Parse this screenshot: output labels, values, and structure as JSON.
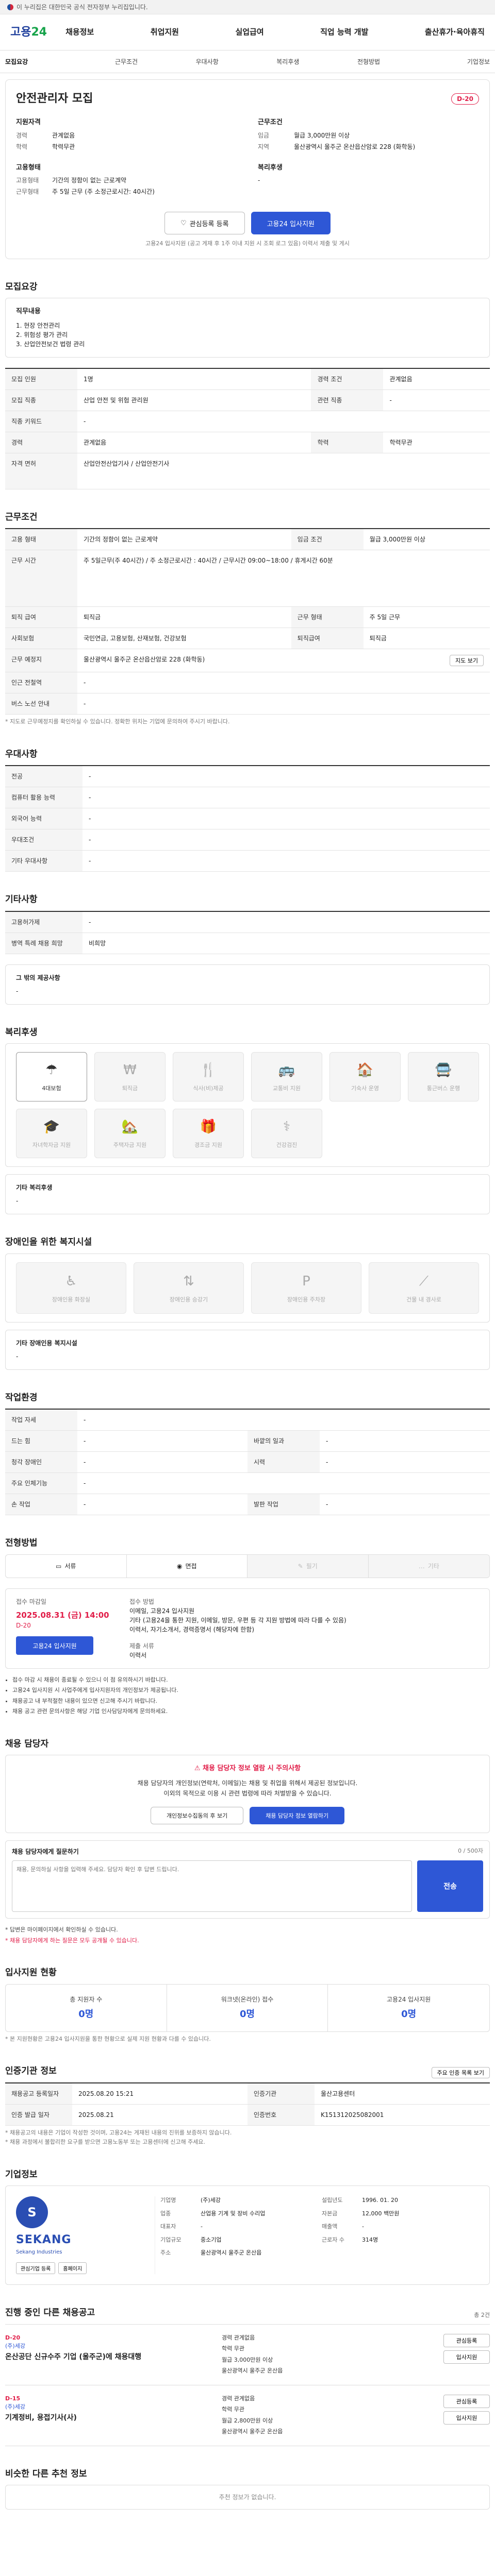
{
  "gov_banner": "이 누리집은 대한민국 공식 전자정부 누리집입니다.",
  "header": {
    "logo_main": "고용",
    "logo_accent": "24",
    "nav": [
      "채용정보",
      "취업지원",
      "실업급여",
      "직업 능력 개발",
      "출산휴가·육아휴직"
    ]
  },
  "tabs": [
    "모집요강",
    "근무조건",
    "우대사항",
    "복리후생",
    "전형방법",
    "기업정보"
  ],
  "job": {
    "title": "안전관리자 모집",
    "dday": "D-20",
    "apply_qualification": {
      "heading": "지원자격",
      "rows": [
        {
          "k": "경력",
          "v": "관계없음"
        },
        {
          "k": "학력",
          "v": "학력무관"
        }
      ]
    },
    "work_conditions": {
      "heading": "근무조건",
      "rows": [
        {
          "k": "임금",
          "v": "월급 3,000만원 이상"
        },
        {
          "k": "지역",
          "v": "울산광역시 울주군 온산읍산암로 228 (화학동)"
        }
      ]
    },
    "employment_type": {
      "heading": "고용형태",
      "rows": [
        {
          "k": "고용형태",
          "v": "기간의 정함이 없는 근로계약"
        },
        {
          "k": "근무형태",
          "v": "주 5일 근무 (주 소정근로시간: 40시간)"
        }
      ]
    },
    "welfare_brief": {
      "heading": "복리후생",
      "value": "-"
    },
    "btn_scrap": "관심등록 등록",
    "btn_apply": "고용24 입사지원",
    "apply_note": "고용24 입사지원 (공고 게재 후 1주 이내 지원 시 조회 로그 있음) 이력서 제출 및 게시"
  },
  "recruit": {
    "title": "모집요강",
    "desc_heading": "직무내용",
    "desc_lines": [
      "1. 현장 안전관리",
      "2. 위험성 평가 관리",
      "3. 산업안전보건 법령 관리"
    ],
    "rows": [
      {
        "k": "모집 인원",
        "v": "1명",
        "k2": "경력 조건",
        "v2": "관계없음"
      },
      {
        "k": "모집 직종",
        "v": "산업 안전 및 위험 관리원",
        "k2": "관련 직종",
        "v2": "-"
      },
      {
        "k": "직종 키워드",
        "v": "-",
        "k2": "",
        "v2": ""
      },
      {
        "k": "경력",
        "v": "관계없음",
        "k2": "학력",
        "v2": "학력무관"
      },
      {
        "k": "자격 면허",
        "v": "산업안전산업기사 / 산업안전기사",
        "k2": "",
        "v2": ""
      }
    ]
  },
  "conditions": {
    "title": "근무조건",
    "rows": [
      {
        "k": "고용 형태",
        "v": "기간의 정함이 없는 근로계약",
        "k2": "임금 조건",
        "v2": "월급 3,000만원 이상"
      },
      {
        "k": "근무 시간",
        "v": "주 5일근무(주 40시간) / 주 소정근로시간 : 40시간 / 근무시간 09:00~18:00 / 휴게시간 60분",
        "k2": "",
        "v2": ""
      },
      {
        "k": "퇴직 급여",
        "v": "퇴직금",
        "k2": "근무 형태",
        "v2": "주 5일 근무"
      },
      {
        "k": "사회보험",
        "v": "국민연금, 고용보험, 산재보험, 건강보험",
        "k2": "퇴직급여",
        "v2": "퇴직금"
      },
      {
        "k": "근무 예정지",
        "v": "울산광역시 울주군 온산읍산암로 228 (화학동)",
        "k2": "",
        "v2": ""
      },
      {
        "k": "인근 전철역",
        "v": "-",
        "k2": "",
        "v2": ""
      },
      {
        "k": "버스 노선 안내",
        "v": "-",
        "k2": "",
        "v2": ""
      }
    ],
    "map_button": "지도 보기",
    "note": "* 지도로 근무예정지를 확인하실 수 있습니다. 정확한 위치는 기업에 문의하여 주시기 바랍니다."
  },
  "preferences": {
    "title": "우대사항",
    "rows": [
      {
        "k": "전공",
        "v": "-"
      },
      {
        "k": "컴퓨터 활용 능력",
        "v": "-"
      },
      {
        "k": "외국어 능력",
        "v": "-"
      },
      {
        "k": "우대조건",
        "v": "-"
      },
      {
        "k": "기타 우대사항",
        "v": "-"
      }
    ]
  },
  "others": {
    "title": "기타사항",
    "rows": [
      {
        "k": "고용허가제",
        "v": "-"
      },
      {
        "k": "병역 특례 채용 희망",
        "v": "비희망"
      }
    ],
    "extra_heading": "그 밖의 제공사항",
    "extra_value": "-"
  },
  "welfare": {
    "title": "복리후생",
    "items": [
      {
        "label": "4대보험",
        "on": true,
        "icon": "☂"
      },
      {
        "label": "퇴직금",
        "on": false,
        "icon": "₩"
      },
      {
        "label": "식사(비)제공",
        "on": false,
        "icon": "🍴"
      },
      {
        "label": "교통비 지원",
        "on": false,
        "icon": "🚌"
      },
      {
        "label": "기숙사 운영",
        "on": false,
        "icon": "🏠"
      },
      {
        "label": "통근버스 운행",
        "on": false,
        "icon": "🚍"
      },
      {
        "label": "자녀학자금 지원",
        "on": false,
        "icon": "🎓"
      },
      {
        "label": "주택자금 지원",
        "on": false,
        "icon": "🏡"
      },
      {
        "label": "경조금 지원",
        "on": false,
        "icon": "🎁"
      },
      {
        "label": "건강검진",
        "on": false,
        "icon": "⚕"
      }
    ],
    "etc_heading": "기타 복리후생",
    "etc_value": "-"
  },
  "disabled_facilities": {
    "title": "장애인을 위한 복지시설",
    "items": [
      {
        "label": "장애인용 화장실",
        "icon": "♿"
      },
      {
        "label": "장애인용 승강기",
        "icon": "⇅"
      },
      {
        "label": "장애인용 주차장",
        "icon": "P"
      },
      {
        "label": "건물 내 경사로",
        "icon": "⟋"
      }
    ],
    "etc_heading": "기타 장애인용 복지시설",
    "etc_value": "-"
  },
  "work_env": {
    "title": "작업환경",
    "rows": [
      {
        "k": "작업 자세",
        "v": "-",
        "k2": "",
        "v2": ""
      },
      {
        "k": "드는 힘",
        "v": "-",
        "k2": "바깥의 일과",
        "v2": "-"
      },
      {
        "k": "청각 장애인",
        "v": "-",
        "k2": "시력",
        "v2": "-"
      },
      {
        "k": "주요 인체기능",
        "v": "-",
        "k2": "",
        "v2": ""
      },
      {
        "k": "손 작업",
        "v": "-",
        "k2": "발판 작업",
        "v2": "-"
      }
    ]
  },
  "selection": {
    "title": "전형방법",
    "methods": [
      {
        "label": "서류",
        "on": true,
        "icon": "▭"
      },
      {
        "label": "면접",
        "on": true,
        "icon": "◉"
      },
      {
        "label": "필기",
        "on": false,
        "icon": "✎"
      },
      {
        "label": "기타",
        "on": false,
        "icon": "…"
      }
    ],
    "deadline_label": "접수 마감일",
    "deadline_value": "2025.08.31 (금) 14:00",
    "deadline_sub": "D-20",
    "apply_btn": "고용24 입사지원",
    "method_label": "접수 방법",
    "method_lines": [
      "이메일, 고용24 입사지원",
      "기타 (고용24을 통한 지원, 이메일, 방문, 우편 등 각 지원 방법에 따라 다를 수 있음)",
      "이력서, 자기소개서, 경력증명서 (해당자에 한함)"
    ],
    "documents_label": "제출 서류",
    "documents_value": "이력서",
    "bullets": [
      "접수 마감 시 채용이 종료될 수 있으니 이 점 유의하시기 바랍니다.",
      "고용24 입사지원 시 사업주에게 입사지원자의 개인정보가 제공됩니다.",
      "채용공고 내 부적절한 내용이 있으면 신고해 주시기 바랍니다.",
      "채용 공고 관련 문의사항은 해당 기업 인사담당자에게 문의하세요."
    ]
  },
  "contact": {
    "title": "채용 담당자",
    "warn_head": "채용 담당자 정보 열람 시 주의사항",
    "warn_body_lines": [
      "채용 담당자의 개인정보(연락처, 이메일)는 채용 및 취업을 위해서 제공된 정보입니다.",
      "이외의 목적으로 이용 시 관련 법령에 따라 처벌받을 수 있습니다."
    ],
    "btn_view": "개인정보수집동의 후 보기",
    "btn_inquiry": "채용 담당자 정보 열람하기",
    "inquiry_heading": "채용 담당자에게 질문하기",
    "inquiry_count": "0 / 500자",
    "inquiry_placeholder": "채용, 문의하실 사항을 입력해 주세요. 담당자 확인 후 답변 드립니다.",
    "send_btn": "전송",
    "notes": [
      "* 답변은 마이페이지에서 확인하실 수 있습니다.",
      "* 채용 담당자에게 하는 질문은 모두 공개될 수 있습니다."
    ]
  },
  "applicant_status": {
    "title": "입사지원 현황",
    "stats": [
      {
        "label": "총 지원자 수",
        "value": "0명"
      },
      {
        "label": "워크넷(온라인) 접수",
        "value": "0명"
      },
      {
        "label": "고용24 입사지원",
        "value": "0명"
      }
    ],
    "note": "* 본 지원현황은 고용24 입사지원을 통한 현황으로 실제 지원 현황과 다를 수 있습니다."
  },
  "certification": {
    "title": "인증기관 정보",
    "btn": "주요 인증 목록 보기",
    "rows": [
      {
        "k": "채용공고 등록일자",
        "v": "2025.08.20 15:21",
        "k2": "인증기관",
        "v2": "울산고용센터"
      },
      {
        "k": "인증 발급 일자",
        "v": "2025.08.21",
        "k2": "인증번호",
        "v2": "K151312025082001"
      }
    ],
    "notes": [
      "* 채용공고의 내용은 기업이 작성한 것이며, 고용24는 게재된 내용의 진위를 보증하지 않습니다.",
      "* 채용 과정에서 불합리한 요구를 받으면 고용노동부 또는 고용센터에 신고해 주세요."
    ]
  },
  "company": {
    "title": "기업정보",
    "logo_mark": "S",
    "logo_name": "SEKANG",
    "logo_sub": "Sekang Industries",
    "btn_follow": "관심기업 등록",
    "btn_home": "홈페이지",
    "info": [
      {
        "k": "기업명",
        "v": "(주)세강",
        "k2": "설립년도",
        "v2": "1996. 01. 20"
      },
      {
        "k": "업종",
        "v": "산업용 기계 및 장비 수리업",
        "k2": "자본금",
        "v2": "12,000 백만원"
      },
      {
        "k": "대표자",
        "v": "-",
        "k2": "매출액",
        "v2": "-"
      },
      {
        "k": "기업규모",
        "v": "중소기업",
        "k2": "근로자 수",
        "v2": "314명"
      },
      {
        "k": "주소",
        "v": "울산광역시 울주군 온산읍",
        "k2": "",
        "v2": ""
      }
    ]
  },
  "other_jobs": {
    "title": "진행 중인 다른 채용공고",
    "count_note": "총 2건",
    "items": [
      {
        "dday": "D-20",
        "comp": "(주)세강",
        "title": "온산공단 신규수주 기업 (울주군)에 채용대행",
        "meta": [
          "경력 관계없음",
          "학력 무관",
          "월급 3,000만원 이상",
          "울산광역시 울주군 온산읍"
        ],
        "btn1": "관심등록",
        "btn2": "입사지원"
      },
      {
        "dday": "D-15",
        "comp": "(주)세강",
        "title": "기계정비, 용접기사(사)",
        "meta": [
          "경력 관계없음",
          "학력 무관",
          "월급 2,800만원 이상",
          "울산광역시 울주군 온산읍"
        ],
        "btn1": "관심등록",
        "btn2": "입사지원"
      }
    ]
  },
  "similar": {
    "title": "비슷한 다른 추천 정보",
    "empty": "추천 정보가 없습니다."
  }
}
